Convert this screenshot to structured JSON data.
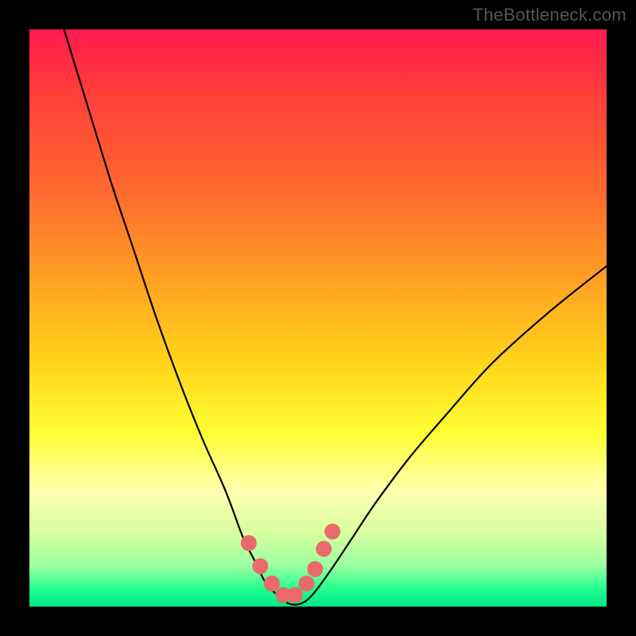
{
  "watermark": "TheBottleneck.com",
  "colors": {
    "page_bg": "#000000",
    "gradient_top": "#ff1a4f",
    "gradient_bottom": "#00e688",
    "curve": "#000000",
    "dots": "#ea6a6a"
  },
  "chart_data": {
    "type": "line",
    "title": "",
    "xlabel": "",
    "ylabel": "",
    "xlim": [
      0,
      100
    ],
    "ylim": [
      0,
      100
    ],
    "grid": false,
    "legend": false,
    "series": [
      {
        "name": "curve",
        "x": [
          6,
          10,
          14,
          18,
          22,
          26,
          30,
          34,
          37,
          39,
          41,
          43,
          45,
          47,
          49,
          52,
          56,
          60,
          66,
          72,
          80,
          90,
          100
        ],
        "y": [
          100,
          87,
          74,
          62,
          50,
          39,
          29,
          20,
          12,
          8,
          4,
          2,
          0.5,
          0.5,
          2,
          6,
          12,
          18,
          26,
          33,
          42,
          51,
          59
        ]
      },
      {
        "name": "highlight-dots",
        "x": [
          38,
          40,
          42,
          44,
          46,
          48,
          49.5,
          51,
          52.5
        ],
        "y": [
          11,
          7,
          4,
          2,
          2,
          4,
          6.5,
          10,
          13
        ]
      }
    ]
  }
}
